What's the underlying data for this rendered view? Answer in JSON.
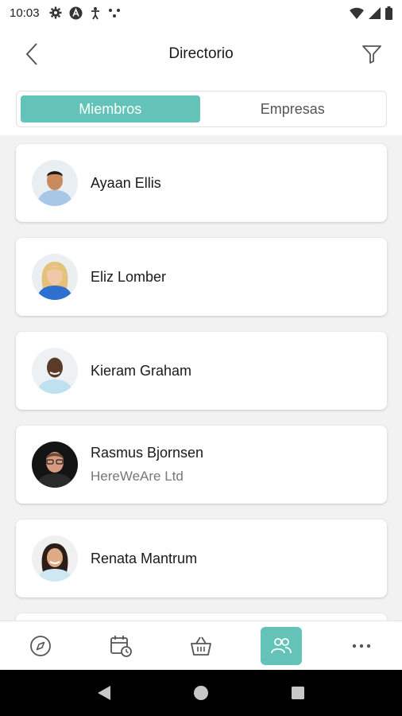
{
  "status_bar": {
    "time": "10:03"
  },
  "header": {
    "title": "Directorio"
  },
  "tabs": [
    {
      "label": "Miembros",
      "active": true
    },
    {
      "label": "Empresas",
      "active": false
    }
  ],
  "members": [
    {
      "name": "Ayaan Ellis",
      "company": ""
    },
    {
      "name": "Eliz Lomber",
      "company": ""
    },
    {
      "name": "Kieram Graham",
      "company": ""
    },
    {
      "name": "Rasmus Bjornsen",
      "company": "HereWeAre Ltd"
    },
    {
      "name": "Renata Mantrum",
      "company": ""
    }
  ],
  "bottom_nav": [
    {
      "icon": "compass-icon",
      "active": false
    },
    {
      "icon": "calendar-clock-icon",
      "active": false
    },
    {
      "icon": "basket-icon",
      "active": false
    },
    {
      "icon": "people-icon",
      "active": true
    },
    {
      "icon": "more-icon",
      "active": false
    }
  ],
  "colors": {
    "accent": "#63c3b8",
    "background": "#f2f2f2",
    "card": "#ffffff",
    "text": "#1a1a1a",
    "muted": "#777777"
  }
}
